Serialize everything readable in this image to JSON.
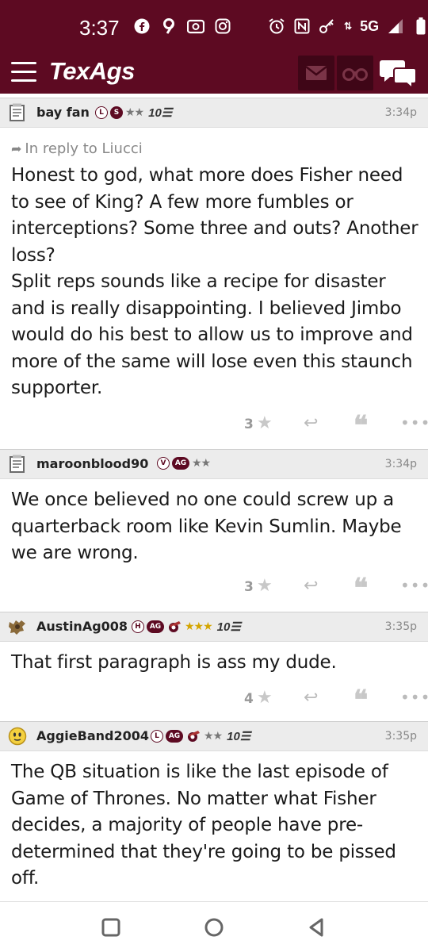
{
  "status_bar": {
    "time": "3:37",
    "network": "5G",
    "left_icons": [
      "facebook-icon",
      "nine-icon",
      "radio-icon",
      "instagram-icon"
    ],
    "right_icons": [
      "alarm-icon",
      "nfc-icon",
      "key-icon",
      "data-arrows-icon",
      "signal-icon",
      "battery-icon"
    ]
  },
  "header": {
    "logo": "TexAgs",
    "brand_color": "#5d0a22"
  },
  "posts": [
    {
      "username": "bay fan",
      "badges": [
        "L",
        "S"
      ],
      "stars": "★★",
      "rank": "10☰",
      "time": "3:34p",
      "reply_to": "In reply to Liucci",
      "text": "Honest to god, what more does Fisher need to see of King? A few more fumbles or interceptions? Some three and outs? Another loss?\nSplit reps sounds like a recipe for disaster and is really disappointing. I believed Jimbo would do his best to allow us to improve and more of the same will lose even this staunch supporter.",
      "star_count": "3"
    },
    {
      "username": "maroonblood90",
      "badges": [
        "V",
        "AG"
      ],
      "stars": "★★",
      "rank": "",
      "time": "3:34p",
      "text": "We once believed no one could screw up a quarterback room like Kevin Sumlin. Maybe we are wrong.",
      "star_count": "3"
    },
    {
      "username": "AustinAg008",
      "badges": [
        "H",
        "AG"
      ],
      "stars": "★★★",
      "rank": "10☰",
      "time": "3:35p",
      "text": "That first paragraph is ass my dude.",
      "star_count": "4"
    },
    {
      "username": "AggieBand2004",
      "badges": [
        "L",
        "AG"
      ],
      "stars": "★★",
      "rank": "10☰",
      "time": "3:35p",
      "text": "The QB situation is like the last episode of Game of Thrones. No matter what Fisher decides, a majority of people have pre-determined that they're going to be pissed off."
    }
  ],
  "actions": {
    "star": "★",
    "reply": "↩",
    "quote": "❝",
    "more": "•••"
  }
}
